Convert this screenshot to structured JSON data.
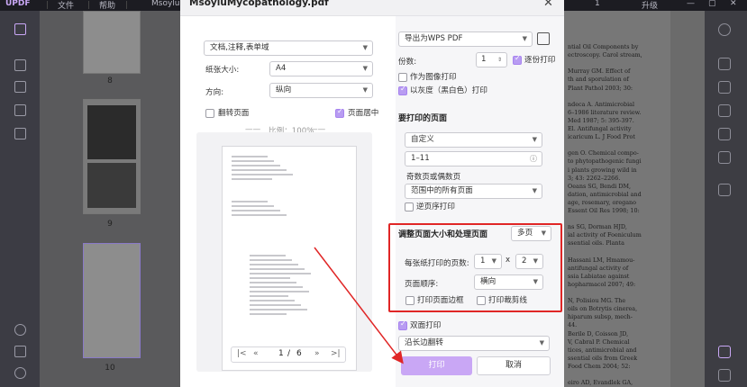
{
  "app": {
    "logo": "UPDF",
    "menu": [
      "文件",
      "帮助"
    ],
    "tab": "Msoylu",
    "page_nav": "1",
    "upgrade": "升级"
  },
  "thumbnails": [
    {
      "label": "8"
    },
    {
      "label": "9"
    },
    {
      "label": "10"
    }
  ],
  "document_text": [
    "ntial Oil Components by",
    "ectroscopy. Carol stream,",
    "",
    "Murray GM. Effect of",
    "th and sporulation of",
    "Plant Pathol 2003; 30:",
    "",
    "ndeca A. Antimicrobial",
    "6–1986 literature review.",
    "Med 1987; 5: 395-397.",
    "El. Antifungal activity",
    "icaricum L. J Food Prot",
    "",
    "gen O. Chemical compo-",
    "to phytopathogenic fungi",
    "i plants growing wild in",
    "3; 43: 2262–2266.",
    "Oeans SG, Bendi DM,",
    "dation, antimicrobial and",
    "age, rosemary, oregano",
    "Essent Oil Res 1998; 10:",
    "",
    "ns SG, Dorman HJD,",
    "ial activity of Foeniculum",
    "ssential oils. Planta",
    "",
    "Hassani LM, Hmamou-",
    "antifungal activity of",
    "ssia Labiatae against",
    "hopharmacol 2007; 49:",
    "",
    "N, Polisiou MG. The",
    "oils on Botrytis cinerea,",
    "hiparum subsp, mech-",
    "44.",
    "Berile D, Coisson JD,",
    "V, Cabral P. Chemical",
    "tices, antimicrobial and",
    "ssential oils from Greek",
    "Food Chem 2004; 52:",
    "",
    "eiro AD, Evandlek GA,",
    "al oils on post-harvest",
    "Braz J Biol Sci"
  ],
  "dialog": {
    "title": "MsoyluMycopathology.pdf",
    "close_icon": "close-icon",
    "left": {
      "content_select": "文档,注释,表单域",
      "paper_size_label": "纸张大小:",
      "paper_size_value": "A4",
      "orientation_label": "方向:",
      "orientation_value": "纵向",
      "flip_page_label": "翻转页面",
      "flip_page_checked": false,
      "center_page_label": "页面居中",
      "center_page_checked": true,
      "scale_text": "比例：100%",
      "pager": {
        "current": "1",
        "separator": "/",
        "total": "6"
      }
    },
    "right": {
      "printer_select": "导出为WPS PDF",
      "printer_icon": "printer-icon",
      "copies_label": "份数:",
      "copies_value": "1",
      "collate_label": "逐份打印",
      "collate_checked": true,
      "print_as_image_label": "作为图像打印",
      "print_as_image_checked": false,
      "grayscale_label": "以灰度（黑白色）打印",
      "grayscale_checked": true,
      "pages_section_title": "要打印的页面",
      "range_select": "自定义",
      "range_input": "1–11",
      "help_icon": "help-icon",
      "odd_even_label": "奇数页或偶数页",
      "odd_even_select": "范围中的所有页面",
      "reverse_label": "逆页序打印",
      "reverse_checked": false,
      "resize_section_title": "调整页面大小和处理页面",
      "mode_select": "多页",
      "pages_per_sheet_label": "每张纸打印的页数:",
      "cols_value": "1",
      "times_symbol": "x",
      "rows_value": "2",
      "page_order_label": "页面顺序:",
      "page_order_value": "横向",
      "print_border_label": "打印页面边框",
      "print_border_checked": false,
      "crop_marks_label": "打印裁剪线",
      "crop_marks_checked": false,
      "duplex_label": "双面打印",
      "duplex_checked": true,
      "flip_select": "沿长边翻转",
      "print_button": "打印",
      "cancel_button": "取消"
    }
  },
  "colors": {
    "accent": "#b89cf2",
    "print_button": "#c9a7f5",
    "highlight_border": "#e02626",
    "arrow": "#e02626"
  }
}
